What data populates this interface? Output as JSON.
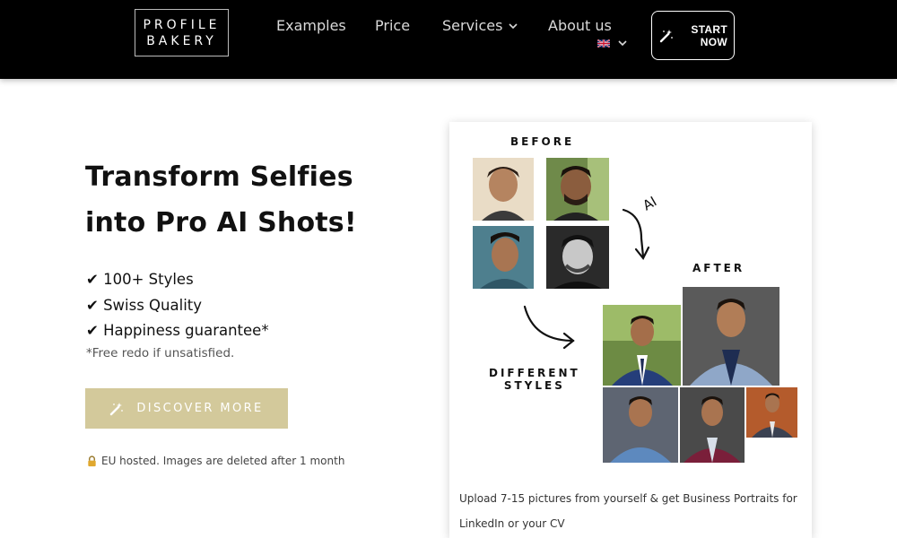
{
  "brand": {
    "line1": "PROFILE",
    "line2": "BAKERY"
  },
  "nav": {
    "examples": "Examples",
    "price": "Price",
    "services": "Services",
    "about": "About us",
    "language_flag": "uk-flag-icon",
    "start_line1": "START",
    "start_line2": "NOW"
  },
  "hero": {
    "headline_line1": "Transform Selfies",
    "headline_line2": "into Pro AI Shots!",
    "features": [
      "✔ 100+ Styles",
      "✔ Swiss Quality",
      "✔ Happiness guarantee*"
    ],
    "note": "*Free redo if unsatisfied.",
    "cta_label": "DISCOVER MORE",
    "eu_note": "EU hosted. Images are deleted after 1 month"
  },
  "showcase": {
    "before_label": "BEFORE",
    "after_label": "AFTER",
    "ai_label": "AI",
    "different_line1": "DIFFERENT",
    "different_line2": "STYLES",
    "caption": "Upload 7-15 pictures from yourself & get Business Portraits for LinkedIn or your CV"
  },
  "colors": {
    "header_bg": "#000000",
    "cta_bg": "#d3c99b",
    "text": "#111111"
  }
}
